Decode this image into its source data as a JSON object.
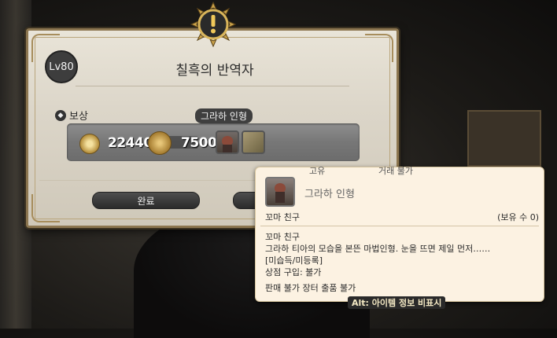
{
  "window": {
    "level": "Lv80",
    "title": "칠흑의 반역자",
    "reward_label": "보상",
    "hover_label": "그라하 인형",
    "rewards": {
      "mgp": "22440",
      "gil": "7500"
    },
    "buttons": {
      "complete": "완료",
      "second": ""
    }
  },
  "tooltip": {
    "tag_unique": "고유",
    "tag_untradable": "거래 불가",
    "name": "그라하 인형",
    "category": "꼬마 친구",
    "owned": "(보유 수 0)",
    "lines": [
      "꼬마 친구",
      "그라하 티아의 모습을 본뜬 마법인형. 눈을 뜨면 제일 먼저……",
      "[미습득/미등록]",
      "상점 구입: 불가"
    ],
    "flags": "판매 불가  장터 출품 불가",
    "alt_hint": "Alt: 아이템 정보 비표시"
  },
  "colors": {
    "window_bg": "#dcd6c9",
    "frame_gold": "#8c7650",
    "tooltip_bg": "#fcf2e2",
    "button_dark": "#2b2b2b"
  },
  "icons": [
    "alert-emblem-icon",
    "level-badge",
    "reward-icon",
    "mgp-icon",
    "gil-icon",
    "doll-item-icon",
    "book-item-icon"
  ]
}
